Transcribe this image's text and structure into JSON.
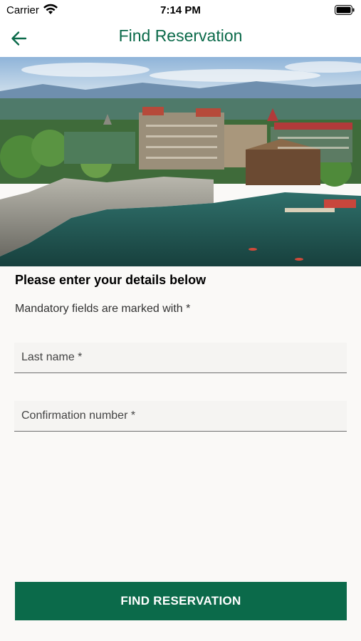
{
  "status_bar": {
    "carrier": "Carrier",
    "time": "7:14 PM",
    "icons": [
      "wifi-icon",
      "battery-icon"
    ]
  },
  "nav": {
    "title": "Find Reservation",
    "back_icon": "arrow-left-icon"
  },
  "hero": {
    "description_icon": "resort-photo"
  },
  "form": {
    "heading": "Please enter your details below",
    "mandatory_note": "Mandatory fields are marked with *",
    "last_name": {
      "placeholder": "Last name *",
      "value": ""
    },
    "confirmation_number": {
      "placeholder": "Confirmation number *",
      "value": ""
    }
  },
  "actions": {
    "find_label": "FIND RESERVATION"
  },
  "colors": {
    "brand_green": "#0b6a4a",
    "background": "#faf9f7"
  }
}
